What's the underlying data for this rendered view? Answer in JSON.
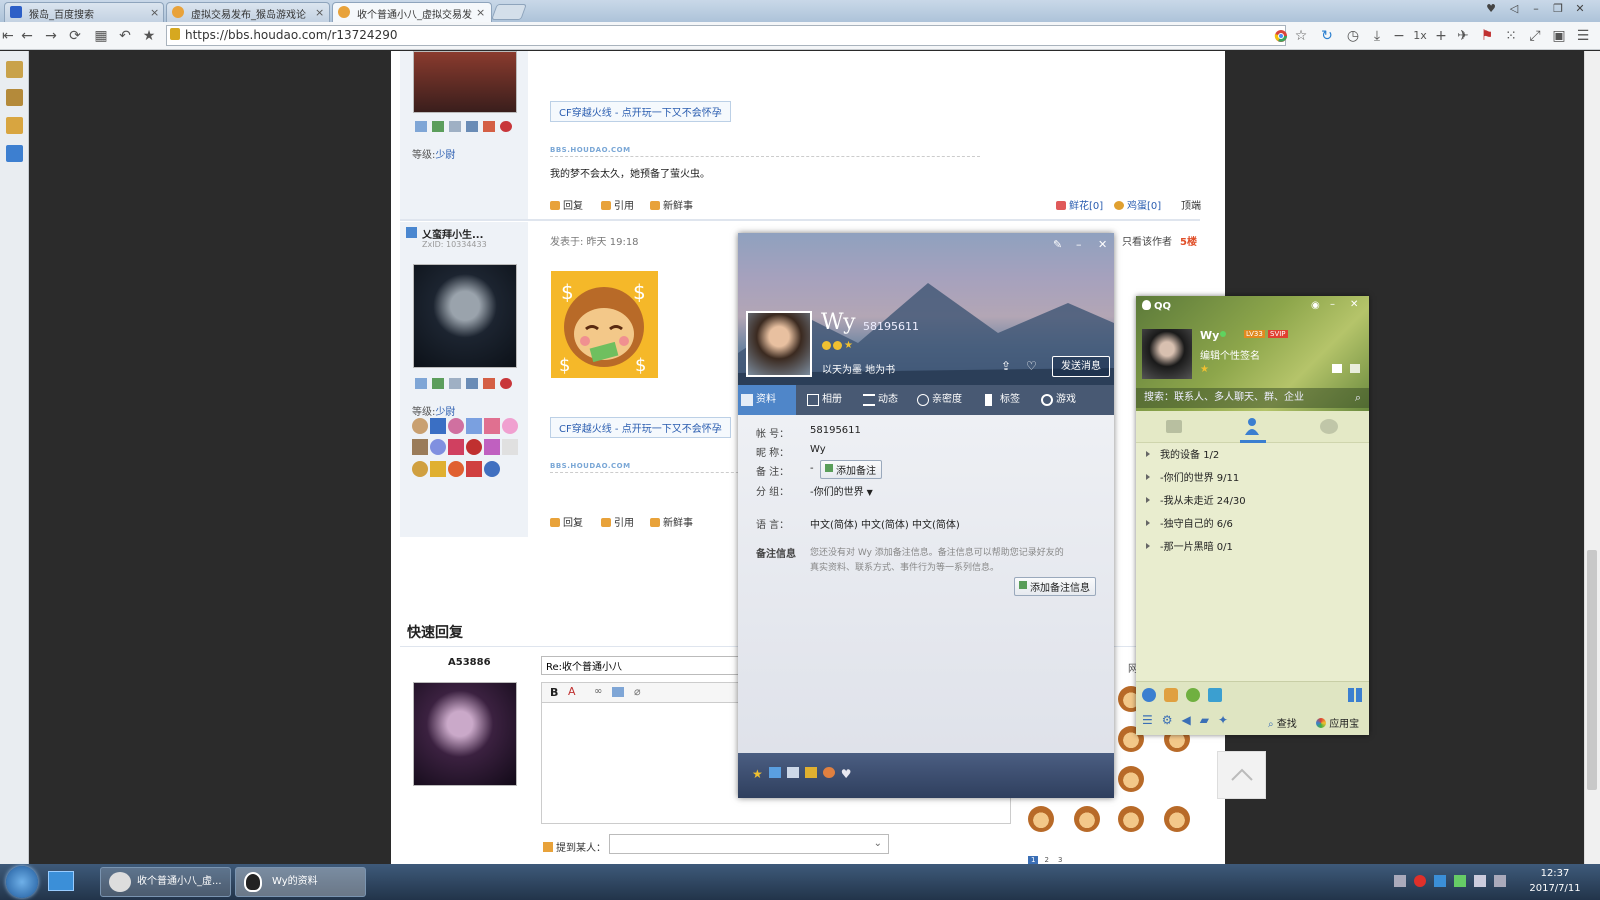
{
  "browser": {
    "tabs": [
      {
        "title": "猴岛_百度搜索",
        "icon": "baidu-icon"
      },
      {
        "title": "虚拟交易发布_猴岛游戏论",
        "icon": "houdao-icon"
      },
      {
        "title": "收个普通小八_虚拟交易发",
        "icon": "houdao-icon",
        "active": true
      }
    ],
    "url": "https://bbs.houdao.com/r13724290",
    "zoom_label": "1x",
    "close_glyph": "×"
  },
  "forum": {
    "post1": {
      "rank_label": "等级:",
      "rank_value": "少尉",
      "cf_link": "CF穿越火线 - 点开玩一下又不会怀孕",
      "logo_text": "BBS.HOUDAO.COM",
      "content": "我的梦不会太久，她预备了萤火虫。",
      "actions": {
        "reply": "回复",
        "quote": "引用",
        "fresh": "新鲜事"
      },
      "flower": "鲜花[0]",
      "egg": "鸡蛋[0]",
      "top": "顶端"
    },
    "post2": {
      "username": "乂蛮拜小生...",
      "zxid": "ZxID: 10334433",
      "posted": "发表于: 昨天 19:18",
      "only_author": "只看该作者",
      "floor": "5楼",
      "rank_label": "等级:",
      "rank_value": "少尉",
      "cf_link": "CF穿越火线 - 点开玩一下又不会怀孕",
      "logo_text": "BBS.HOUDAO.COM",
      "actions": {
        "reply": "回复",
        "quote": "引用",
        "fresh": "新鲜事"
      }
    },
    "quick_reply": {
      "title": "快速回复",
      "user": "A53886",
      "subject_value": "Re:收个普通小八",
      "mention_label": "提到某人：",
      "pages": [
        "1",
        "2",
        "3"
      ],
      "side_char": "网"
    }
  },
  "profile": {
    "name": "Wy",
    "qq": "58195611",
    "signature": "以天为墨 地为书",
    "send_btn": "发送消息",
    "tabs": [
      "资料",
      "相册",
      "动态",
      "亲密度",
      "标签",
      "游戏"
    ],
    "fields": {
      "account_label": "帐    号：",
      "account": "58195611",
      "nick_label": "昵    称：",
      "nick": "Wy",
      "remark_label": "备    注：",
      "remark": "-",
      "add_remark": "添加备注",
      "group_label": "分    组：",
      "group": "-你们的世界",
      "lang_label": "语    言：",
      "lang": "中文(简体)  中文(简体)  中文(简体)",
      "info_label": "备注信息",
      "info_line1": "您还没有对 Wy 添加备注信息。备注信息可以帮助您记录好友的",
      "info_line2": "真实资料、联系方式、事件行为等一系列信息。",
      "add_info": "添加备注信息"
    }
  },
  "qq": {
    "title": "QQ",
    "nick": "Wy",
    "level": "LV33",
    "vip": "SVIP",
    "signature": "编辑个性签名",
    "search_placeholder": "搜索：联系人、多人聊天、群、企业",
    "groups": [
      {
        "name": "我的设备",
        "count": "1/2"
      },
      {
        "name": "-你们的世界",
        "count": "9/11"
      },
      {
        "name": "-我从未走近",
        "count": "24/30"
      },
      {
        "name": "-独守自己的",
        "count": "6/6"
      },
      {
        "name": "-那一片黑暗",
        "count": "0/1"
      }
    ],
    "find": "查找",
    "apps": "应用宝"
  },
  "taskbar": {
    "tasks": [
      "收个普通小八_虚...",
      "Wy的资料"
    ],
    "time": "12:37",
    "date": "2017/7/11"
  },
  "colors": {
    "link": "#2a5db0",
    "floor": "#e0502a",
    "accent": "#3b6fb6"
  }
}
